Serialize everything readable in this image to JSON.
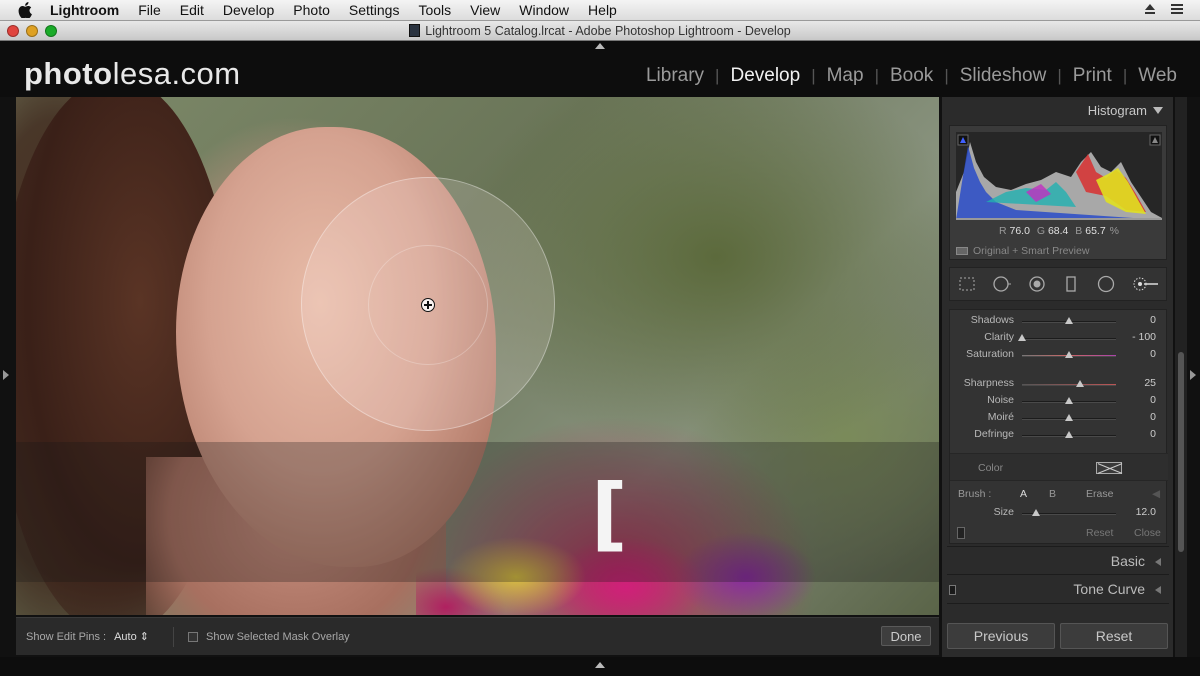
{
  "menubar": {
    "app": "Lightroom",
    "items": [
      "File",
      "Edit",
      "Develop",
      "Photo",
      "Settings",
      "Tools",
      "View",
      "Window",
      "Help"
    ],
    "icons": [
      "apple-icon",
      "eject-icon",
      "menu-list-icon"
    ]
  },
  "window": {
    "title": "Lightroom 5 Catalog.lrcat - Adobe Photoshop Lightroom - Develop"
  },
  "header": {
    "logo_bold": "photo",
    "logo_rest": "lesa.com",
    "modules": [
      {
        "label": "Library",
        "active": false
      },
      {
        "label": "Develop",
        "active": true
      },
      {
        "label": "Map",
        "active": false
      },
      {
        "label": "Book",
        "active": false
      },
      {
        "label": "Slideshow",
        "active": false
      },
      {
        "label": "Print",
        "active": false
      },
      {
        "label": "Web",
        "active": false
      }
    ]
  },
  "canvas": {
    "bracket_glyph": "["
  },
  "toolbar": {
    "edit_pins_label": "Show Edit Pins :",
    "edit_pins_value": "Auto",
    "mask_overlay_label": "Show Selected Mask Overlay",
    "mask_overlay_checked": false,
    "done_label": "Done"
  },
  "histogram": {
    "title": "Histogram",
    "r_label": "R",
    "r_value": "76.0",
    "g_label": "G",
    "g_value": "68.4",
    "b_label": "B",
    "b_value": "65.7",
    "unit": "%",
    "smart_preview": "Original + Smart Preview"
  },
  "tools": [
    "crop-overlay-icon",
    "spot-removal-icon",
    "red-eye-icon",
    "graduated-filter-icon",
    "radial-filter-icon",
    "adjustment-brush-icon"
  ],
  "adjustment_brush": {
    "sliders": [
      {
        "label": "Shadows",
        "value": "0",
        "pos": 0.5
      },
      {
        "label": "Clarity",
        "value": "- 100",
        "pos": 0.0
      },
      {
        "label": "Saturation",
        "value": "0",
        "pos": 0.5,
        "track": "color"
      },
      {
        "label": "Sharpness",
        "value": "25",
        "pos": 0.62,
        "track": "sharp"
      },
      {
        "label": "Noise",
        "value": "0",
        "pos": 0.5
      },
      {
        "label": "Moiré",
        "value": "0",
        "pos": 0.5
      },
      {
        "label": "Defringe",
        "value": "0",
        "pos": 0.5
      }
    ],
    "color_label": "Color",
    "brush_label": "Brush :",
    "brush_a": "A",
    "brush_b": "B",
    "brush_erase": "Erase",
    "size_label": "Size",
    "size_value": "12.0",
    "size_pos": 0.15,
    "reset_label": "Reset",
    "close_label": "Close"
  },
  "panels": {
    "basic": "Basic",
    "tone_curve": "Tone Curve"
  },
  "buttons": {
    "previous": "Previous",
    "reset": "Reset"
  }
}
